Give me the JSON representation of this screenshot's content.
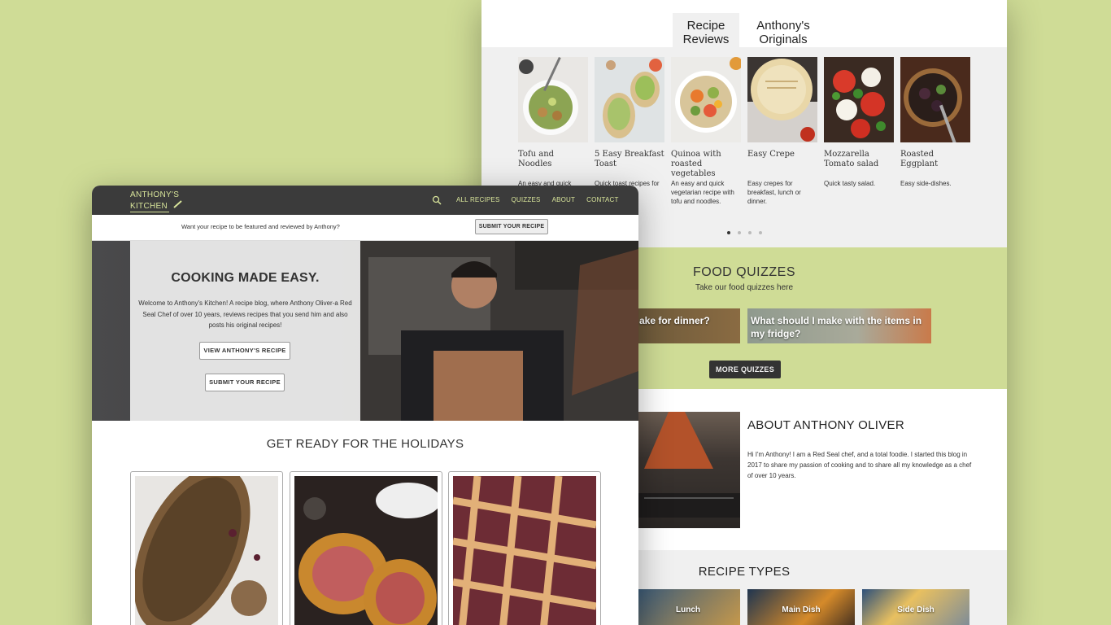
{
  "back": {
    "tabs": [
      {
        "label_line1": "Recipe",
        "label_line2": "Reviews"
      },
      {
        "label_line1": "Anthony's",
        "label_line2": "Originals"
      }
    ],
    "recipe_cards": [
      {
        "name": "Tofu and Noodles",
        "desc": "An easy and quick"
      },
      {
        "name": "5 Easy Breakfast Toast",
        "desc": "Quick toast recipes for"
      },
      {
        "name": "Quinoa with roasted vegetables",
        "desc": "An easy and quick vegetarian recipe with tofu and noodles."
      },
      {
        "name": "Easy Crepe",
        "desc": "Easy crepes for breakfast, lunch or dinner."
      },
      {
        "name": "Mozzarella Tomato salad",
        "desc": "Quick tasty salad."
      },
      {
        "name": "Roasted Eggplant",
        "desc": "Easy side-dishes."
      }
    ],
    "quizzes": {
      "title": "FOOD QUIZZES",
      "subtitle": "Take our food quizzes here",
      "card1": "ake for dinner?",
      "card2": "What should I make with the items in my fridge?",
      "more_label": "MORE QUIZZES"
    },
    "about": {
      "title": "ABOUT ANTHONY OLIVER",
      "text": "Hi I'm Anthony! I am a Red Seal chef, and a total foodie. I started this blog in 2017 to share my passion of cooking and to share all my knowledge as a chef of over 10 years."
    },
    "types": {
      "title": "RECIPE TYPES",
      "items": [
        "Lunch",
        "Main Dish",
        "Side Dish"
      ]
    }
  },
  "front": {
    "logo_line1": "ANTHONY'S",
    "logo_line2": "KITCHEN",
    "nav": [
      "ALL RECIPES",
      "QUIZZES",
      "ABOUT",
      "CONTACT"
    ],
    "banner_text": "Want your recipe to be featured and reviewed by Anthony?",
    "banner_button": "SUBMIT YOUR RECIPE",
    "hero": {
      "title": "COOKING MADE EASY.",
      "text": "Welcome to Anthony's Kitchen!  A recipe blog, where Anthony Oliver-a Red Seal Chef of over 10 years, reviews recipes that you send him and also posts his original recipes!",
      "btn_view": "VIEW ANTHONY'S RECIPE",
      "btn_submit": "SUBMIT YOUR RECIPE"
    },
    "holidays_title": "GET READY FOR THE HOLIDAYS"
  },
  "colors": {
    "accent": "#d8e49a",
    "background": "#cfdc96",
    "nav": "#3b3b3b"
  },
  "icons": {
    "search": "search-icon",
    "knife": "knife-icon"
  }
}
